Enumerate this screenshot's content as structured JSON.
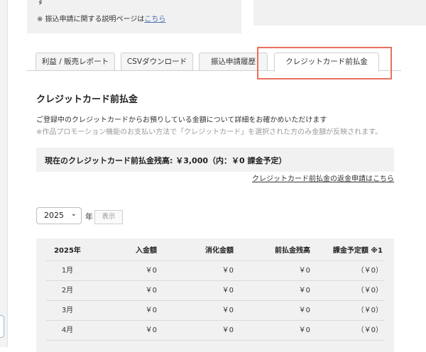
{
  "top_notice": {
    "cut_text": "す",
    "note_prefix": "※ 振込申請に関する説明ページは",
    "note_link": "こちら"
  },
  "tabs": [
    {
      "label": "利益 / 販売レポート"
    },
    {
      "label": "CSVダウンロード"
    },
    {
      "label": "振込申請履歴"
    },
    {
      "label": "クレジットカード前払金",
      "active": true
    }
  ],
  "section": {
    "title": "クレジットカード前払金",
    "description": "ご登録中のクレジットカードからお預りしている金額について詳細をお確かめいただけます",
    "sub_description": "※作品プロモーション機能のお支払い方法で「クレジットカード」を選択された方のみ金額が反映されます。"
  },
  "balance": {
    "text": "現在のクレジットカード前払金残高: ￥3,000（内：￥0 課金予定）",
    "refund_link": "クレジットカード前払金の返金申請はこちら"
  },
  "filter": {
    "year_value": "2025",
    "year_suffix": "年",
    "show_label": "表示"
  },
  "table": {
    "headers": [
      "2025年",
      "入金額",
      "消化金額",
      "前払金残高",
      "課金予定額 ※1"
    ],
    "rows": [
      [
        "1月",
        "￥0",
        "￥0",
        "￥0",
        "（￥0）"
      ],
      [
        "2月",
        "￥0",
        "￥0",
        "￥0",
        "（￥0）"
      ],
      [
        "3月",
        "￥0",
        "￥0",
        "￥0",
        "（￥0）"
      ],
      [
        "4月",
        "￥0",
        "￥0",
        "￥0",
        "（￥0）"
      ]
    ]
  },
  "colors": {
    "highlight": "#e8705d",
    "link": "#4a6fb5",
    "panel_bg": "#f1f1f1"
  },
  "icons": {
    "year_dropdown": "chevron-down-icon"
  }
}
